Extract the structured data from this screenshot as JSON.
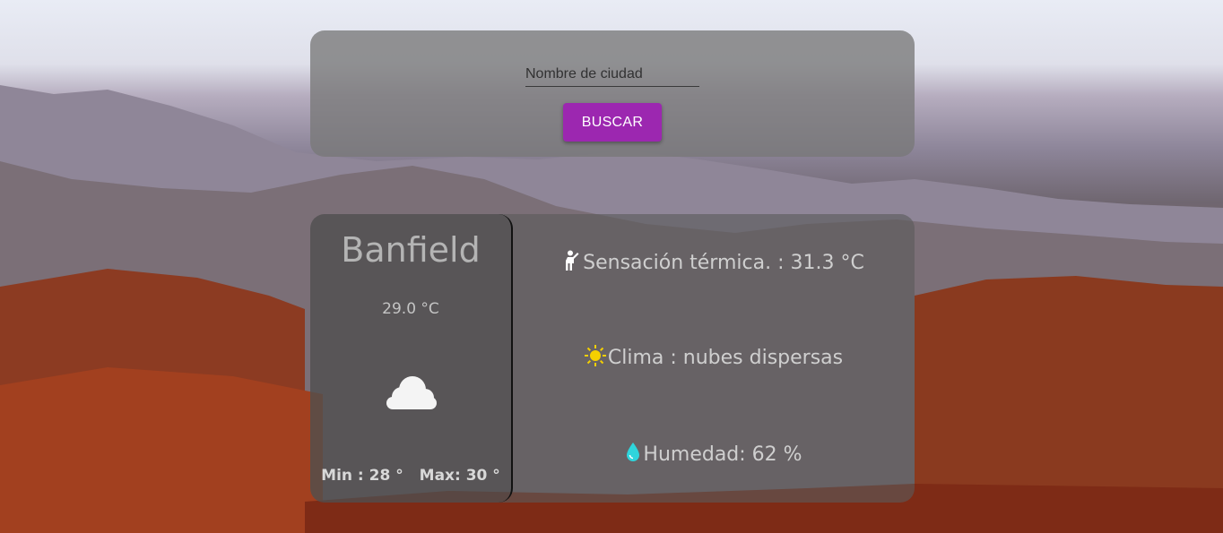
{
  "search": {
    "placeholder": "Nombre de ciudad",
    "button_label": "BUSCAR"
  },
  "weather": {
    "city": "Banfield",
    "temperature": "29.0 °C",
    "min": "Min : 28 °",
    "max": "Max: 30 °",
    "feels_like": "Sensación térmica. : 31.3 °C",
    "clima": "Clima : nubes dispersas",
    "humedad": "Humedad: 62 %"
  },
  "icons": {
    "condition": "cloud-icon",
    "feels_like": "person-icon",
    "clima": "sun-icon",
    "humedad": "water-drop-icon"
  },
  "colors": {
    "button": "#9c27b0",
    "sun": "#f5d000",
    "drop": "#2fd5dc"
  }
}
